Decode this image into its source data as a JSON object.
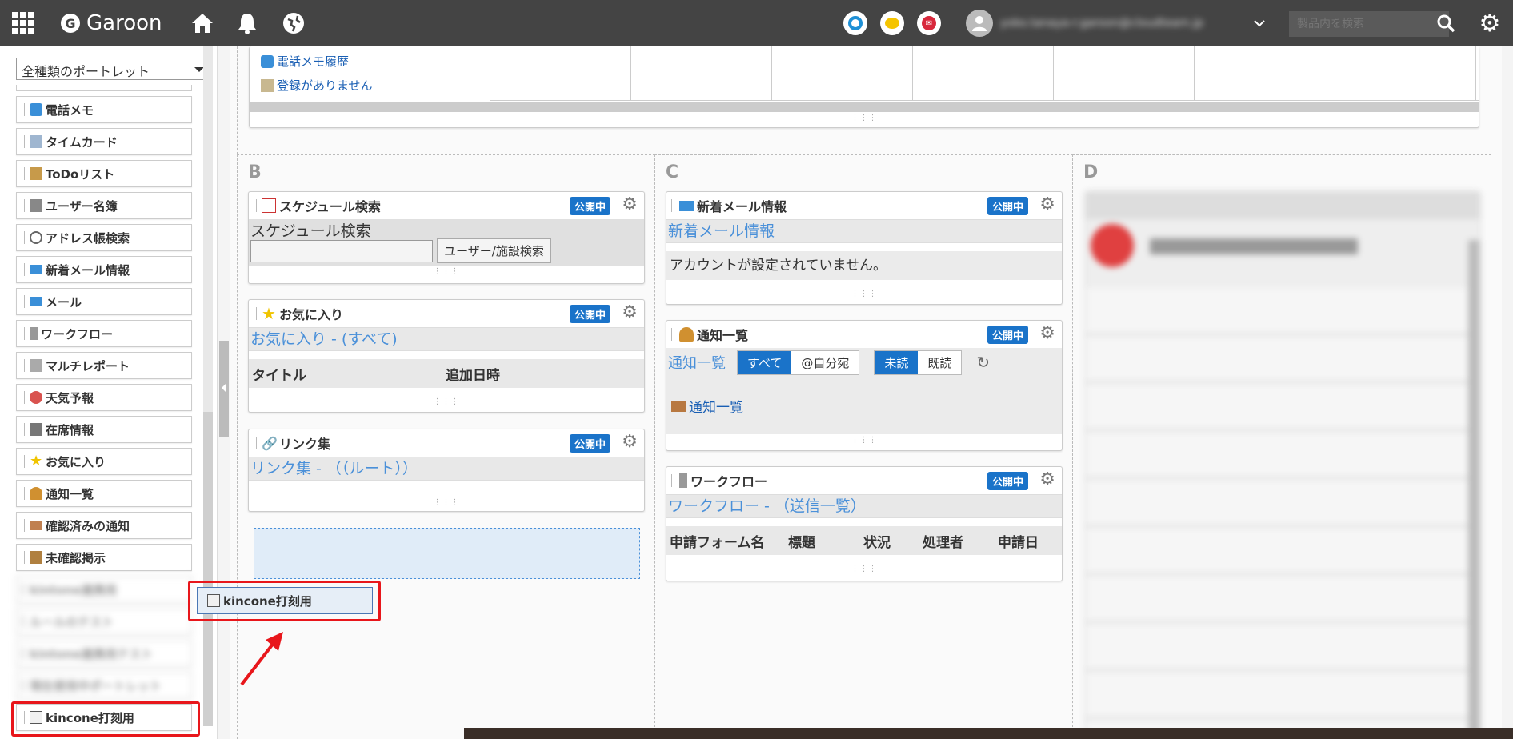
{
  "header": {
    "app_name": "Garoon",
    "user_email": "yoko.tanaya-r.garoon@cloudteam.jp",
    "search_placeholder": "製品内を検索"
  },
  "sidebar": {
    "portlet_type": "全種類のポートレット",
    "items": [
      {
        "label": "電話メモ",
        "icon": "phone-memo-icon"
      },
      {
        "label": "タイムカード",
        "icon": "timecard-icon"
      },
      {
        "label": "ToDoリスト",
        "icon": "todo-icon"
      },
      {
        "label": "ユーザー名簿",
        "icon": "user-directory-icon"
      },
      {
        "label": "アドレス帳検索",
        "icon": "address-book-icon"
      },
      {
        "label": "新着メール情報",
        "icon": "mail-icon"
      },
      {
        "label": "メール",
        "icon": "mail-icon"
      },
      {
        "label": "ワークフロー",
        "icon": "workflow-icon"
      },
      {
        "label": "マルチレポート",
        "icon": "multireport-icon"
      },
      {
        "label": "天気予報",
        "icon": "weather-icon"
      },
      {
        "label": "在席情報",
        "icon": "presence-icon"
      },
      {
        "label": "お気に入り",
        "icon": "star-icon"
      },
      {
        "label": "通知一覧",
        "icon": "bell-icon"
      },
      {
        "label": "確認済みの通知",
        "icon": "inbox-icon"
      },
      {
        "label": "未確認掲示",
        "icon": "bulletin-icon"
      }
    ],
    "blurred_items": [
      "kintone連携用",
      "ルールのテスト",
      "kintone連携用テスト",
      "現在使用中ポートレット"
    ],
    "highlighted_item": "kincone打刻用"
  },
  "top_portlet": {
    "link1": "電話メモ履歴",
    "link2": "登録がありません"
  },
  "columns": {
    "b": "B",
    "c": "C",
    "d": "D"
  },
  "badge": "公開中",
  "portlets": {
    "schedule_search": {
      "title": "スケジュール検索",
      "subtitle": "スケジュール検索",
      "button": "ユーザー/施設検索"
    },
    "favorites": {
      "title": "お気に入り",
      "subtitle": "お気に入り - (すべて)",
      "col_title": "タイトル",
      "col_date": "追加日時"
    },
    "links": {
      "title": "リンク集",
      "subtitle": "リンク集 - （（ルート））"
    },
    "new_mail": {
      "title": "新着メール情報",
      "subtitle": "新着メール情報",
      "message": "アカウントが設定されていません。"
    },
    "notifications": {
      "title": "通知一覧",
      "subtitle": "通知一覧",
      "filter_all": "すべて",
      "filter_mine": "@自分宛",
      "filter_unread": "未読",
      "filter_read": "既読",
      "link": "通知一覧"
    },
    "workflow": {
      "title": "ワークフロー",
      "subtitle": "ワークフロー - （送信一覧）",
      "cols": [
        "申請フォーム名",
        "標題",
        "状況",
        "処理者",
        "申請日"
      ]
    }
  },
  "drag_item": "kincone打刻用"
}
